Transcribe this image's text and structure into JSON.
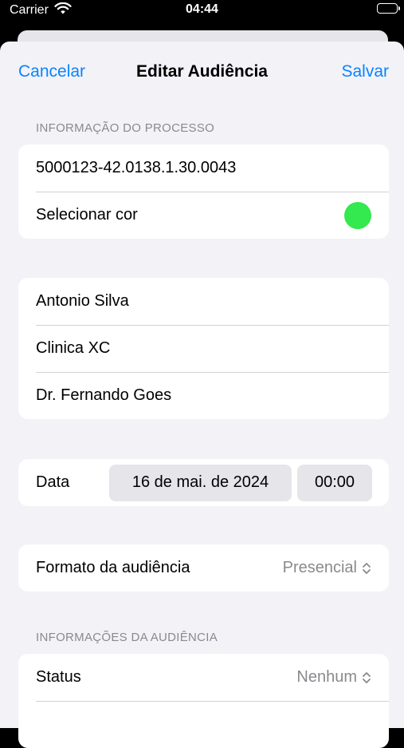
{
  "status_bar": {
    "carrier": "Carrier",
    "time": "04:44"
  },
  "nav": {
    "cancel_label": "Cancelar",
    "title": "Editar Audiência",
    "save_label": "Salvar"
  },
  "process_section": {
    "header": "INFORMAÇÃO DO PROCESSO",
    "process_number": "5000123-42.0138.1.30.0043",
    "color_label": "Selecionar cor",
    "selected_color": "#34e84f"
  },
  "parties": {
    "items": [
      "Antonio Silva",
      "Clinica XC",
      "Dr. Fernando Goes"
    ]
  },
  "datetime": {
    "label": "Data",
    "date": "16 de mai. de 2024",
    "time": "00:00"
  },
  "format": {
    "label": "Formato da audiência",
    "value": "Presencial"
  },
  "hearing_section": {
    "header": "INFORMAÇÕES DA AUDIÊNCIA",
    "status_label": "Status",
    "status_value": "Nenhum"
  },
  "colors": {
    "accent": "#0a84ff",
    "sheet_bg": "#f2f2f7",
    "secondary_text": "#8a8a8e"
  }
}
